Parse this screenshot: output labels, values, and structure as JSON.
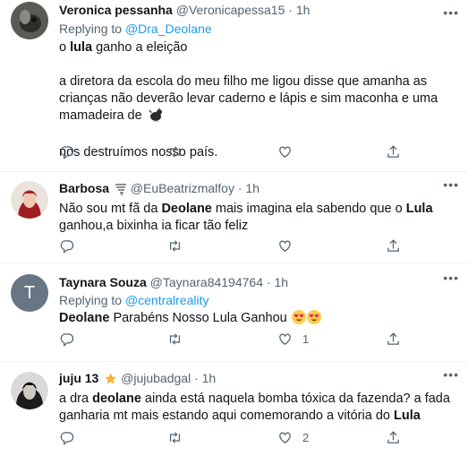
{
  "tweets": [
    {
      "name": "Veronica pessanha",
      "handle": "@Veronicapessa15",
      "dot": "·",
      "time": "1h",
      "reply_prefix": "Replying to",
      "reply_to": "@Dra_Deolane",
      "line1_a": "o ",
      "line1_bold": "lula",
      "line1_b": " ganho a eleição",
      "para2": "a diretora da escola do meu filho me ligou disse que amanha as crianças não deverão levar caderno e lápis e sim maconha e uma mamadeira de",
      "para3": "nos destruímos nosso país."
    },
    {
      "name": "Barbosa",
      "handle": "@EuBeatrizmalfoy",
      "dot": "·",
      "time": "1h",
      "t1": "Não sou mt fã da ",
      "b1": "Deolane",
      "t2": " mais imagina ela sabendo que o ",
      "b2": "Lula",
      "t3": " ganhou,a bixinha ia ficar tão feliz"
    },
    {
      "name": "Taynara Souza",
      "handle": "@Taynara84194764",
      "dot": "·",
      "time": "1h",
      "avatar_letter": "T",
      "reply_prefix": "Replying to",
      "reply_to": "@centralreality",
      "b1": "Deolane",
      "t1": " Parabéns Nosso Lula Ganhou ",
      "like_count": "1"
    },
    {
      "name": "juju 13",
      "handle": "@jujubadgal",
      "dot": "·",
      "time": "1h",
      "t1": "a dra ",
      "b1": "deolane",
      "t2": " ainda está naquela bomba tóxica da fazenda? a fada ganharia mt mais estando aqui comemorando a vitória do ",
      "b2": "Lula",
      "like_count": "2"
    }
  ],
  "icons": [
    "more-icon",
    "reply-icon",
    "retweet-icon",
    "like-icon",
    "share-icon",
    "rooster-emoji",
    "heart-eyes-emoji",
    "star-emoji",
    "tornado-emoji"
  ],
  "colors": {
    "link": "#1d9bf0",
    "secondary": "#536471",
    "text": "#0f1419",
    "divider": "#eff3f4",
    "taynara_avatar": "#687684"
  }
}
